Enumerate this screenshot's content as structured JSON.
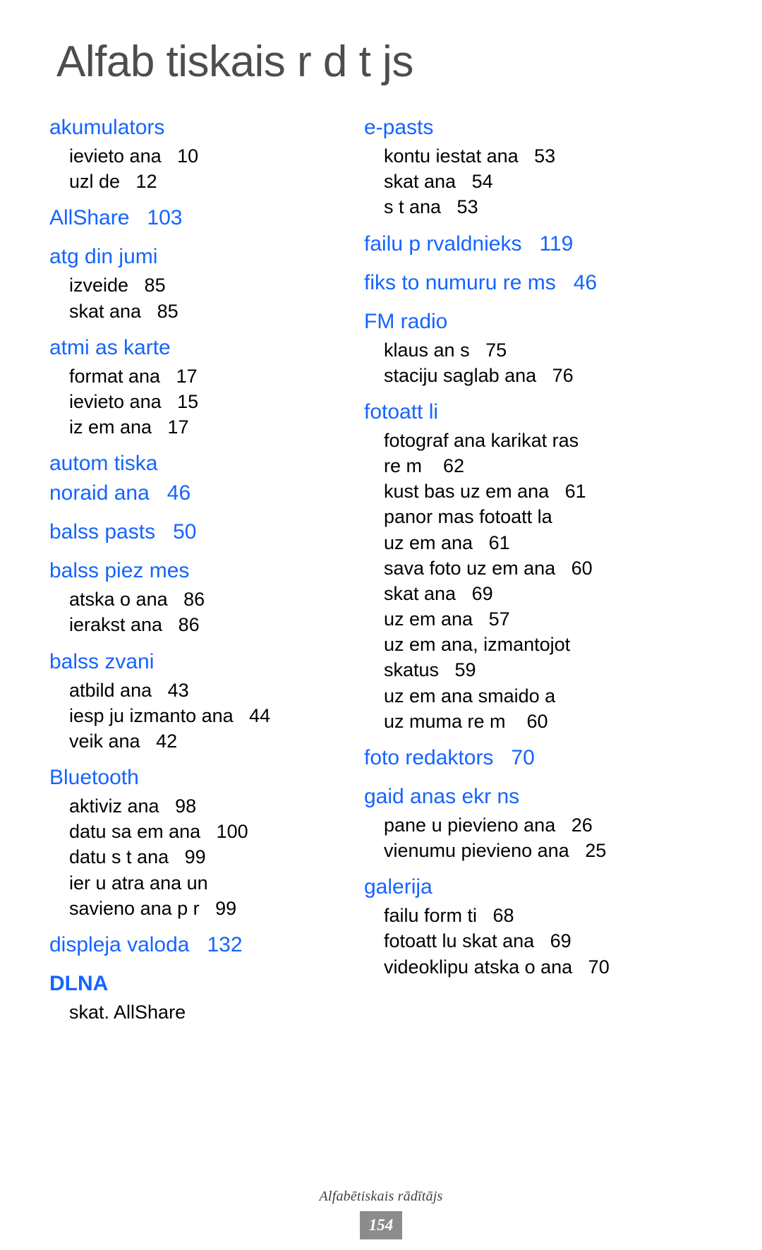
{
  "title": "Alfab tiskais r d t js",
  "colors": {
    "headword": "#1464FF",
    "subentry": "#000000",
    "title": "#4D4D4D",
    "badge": "#8C8C8C"
  },
  "footer": {
    "label": "Alfabētiskais rādītājs",
    "page_number": "154"
  },
  "columns": [
    {
      "entries": [
        {
          "headword": "akumulators",
          "subentries": [
            "ievieto ana   10",
            "uzl de   12"
          ]
        },
        {
          "headword": "AllShare   103",
          "subentries": []
        },
        {
          "headword": "atg din jumi",
          "subentries": [
            "izveide   85",
            "skat ana   85"
          ]
        },
        {
          "headword": "atmi as karte",
          "subentries": [
            "format ana   17",
            "ievieto ana   15",
            "iz em ana   17"
          ]
        },
        {
          "headword": "autom tiska\nnoraid ana   46",
          "subentries": []
        },
        {
          "headword": "balss pasts   50",
          "subentries": []
        },
        {
          "headword": "balss piez mes",
          "subentries": [
            "atska o ana   86",
            "ierakst ana   86"
          ]
        },
        {
          "headword": "balss zvani",
          "subentries": [
            "atbild ana   43",
            "iesp ju izmanto ana   44",
            "veik ana   42"
          ]
        },
        {
          "headword": "Bluetooth",
          "subentries": [
            "aktiviz ana   98",
            "datu sa em ana   100",
            "datu s t ana   99",
            "ier u atra ana un\nsavieno ana p r   99"
          ]
        },
        {
          "headword": "displeja valoda   132",
          "subentries": []
        },
        {
          "headword": "DLNA",
          "bold": true,
          "subentries": [
            "skat. AllShare"
          ]
        }
      ]
    },
    {
      "entries": [
        {
          "headword": "e-pasts",
          "subentries": [
            "kontu iestat ana   53",
            "skat ana   54",
            "s t ana   53"
          ]
        },
        {
          "headword": "failu p rvaldnieks   119",
          "subentries": []
        },
        {
          "headword": "fiks to numuru re ms   46",
          "subentries": []
        },
        {
          "headword": "FM radio",
          "subentries": [
            "klaus an s   75",
            "staciju saglab ana   76"
          ]
        },
        {
          "headword": "fotoatt li",
          "subentries": [
            "fotograf ana karikat ras\nre m    62",
            "kust bas uz em ana   61",
            "panor mas fotoatt la\nuz em ana   61",
            "sava foto uz em ana   60",
            "skat ana   69",
            "uz em ana   57",
            "uz em ana, izmantojot\nskatus   59",
            "uz em ana smaido a\nuz muma re m    60"
          ]
        },
        {
          "headword": "foto redaktors   70",
          "subentries": []
        },
        {
          "headword": "gaid anas ekr ns",
          "subentries": [
            "pane u pievieno ana   26",
            "vienumu pievieno ana   25"
          ]
        },
        {
          "headword": "galerija",
          "subentries": [
            "failu form ti   68",
            "fotoatt lu skat ana   69",
            "videoklipu atska o ana   70"
          ]
        }
      ]
    }
  ]
}
